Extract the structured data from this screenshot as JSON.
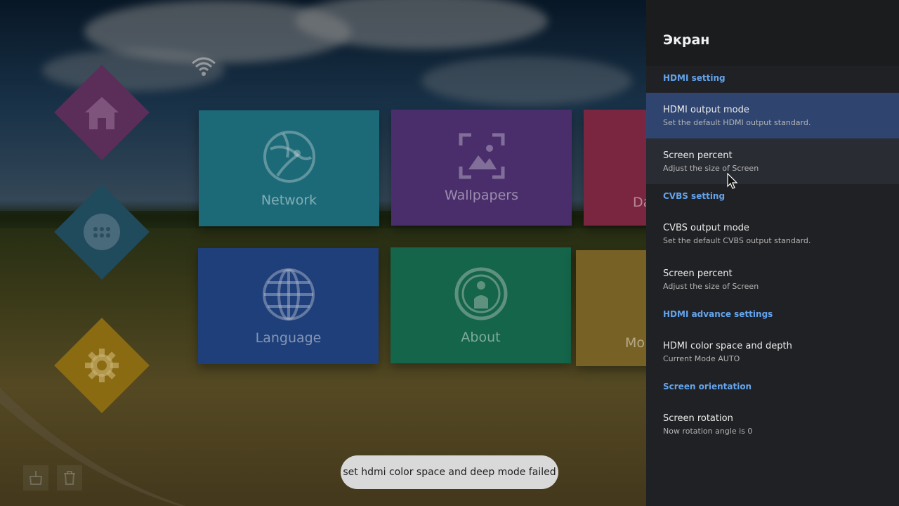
{
  "launcher": {
    "tiles": [
      {
        "label": "Network",
        "icon": "network-globe-icon"
      },
      {
        "label": "Wallpapers",
        "icon": "wallpaper-image-icon"
      },
      {
        "label": "Da",
        "icon": "display-icon"
      },
      {
        "label": "Language",
        "icon": "language-globe-icon"
      },
      {
        "label": "About",
        "icon": "about-person-icon"
      },
      {
        "label": "Mo",
        "icon": "more-icon"
      }
    ],
    "nav": [
      "home-icon",
      "apps-icon",
      "settings-gear-icon"
    ]
  },
  "panel": {
    "title": "Экран",
    "sections": {
      "hdmi": "HDMI setting",
      "cvbs": "CVBS setting",
      "hdmi_advance": "HDMI advance settings",
      "orientation": "Screen orientation"
    },
    "rows": {
      "hdmi_output": {
        "title": "HDMI output mode",
        "subtitle": "Set the default HDMI output standard."
      },
      "hdmi_screen_percent": {
        "title": "Screen percent",
        "subtitle": "Adjust the size of Screen"
      },
      "cvbs_output": {
        "title": "CVBS output mode",
        "subtitle": "Set the default CVBS output standard."
      },
      "cvbs_screen_percent": {
        "title": "Screen percent",
        "subtitle": "Adjust the size of Screen"
      },
      "color_space": {
        "title": "HDMI color space and depth",
        "subtitle": "Current Mode AUTO"
      },
      "rotation": {
        "title": "Screen rotation",
        "subtitle": "Now rotation angle is 0"
      }
    }
  },
  "toast": {
    "message": "set hdmi color space and deep mode failed"
  },
  "colors": {
    "accent": "#63a4ee",
    "focused_row": "#2f4570",
    "panel_bg": "#202124"
  }
}
